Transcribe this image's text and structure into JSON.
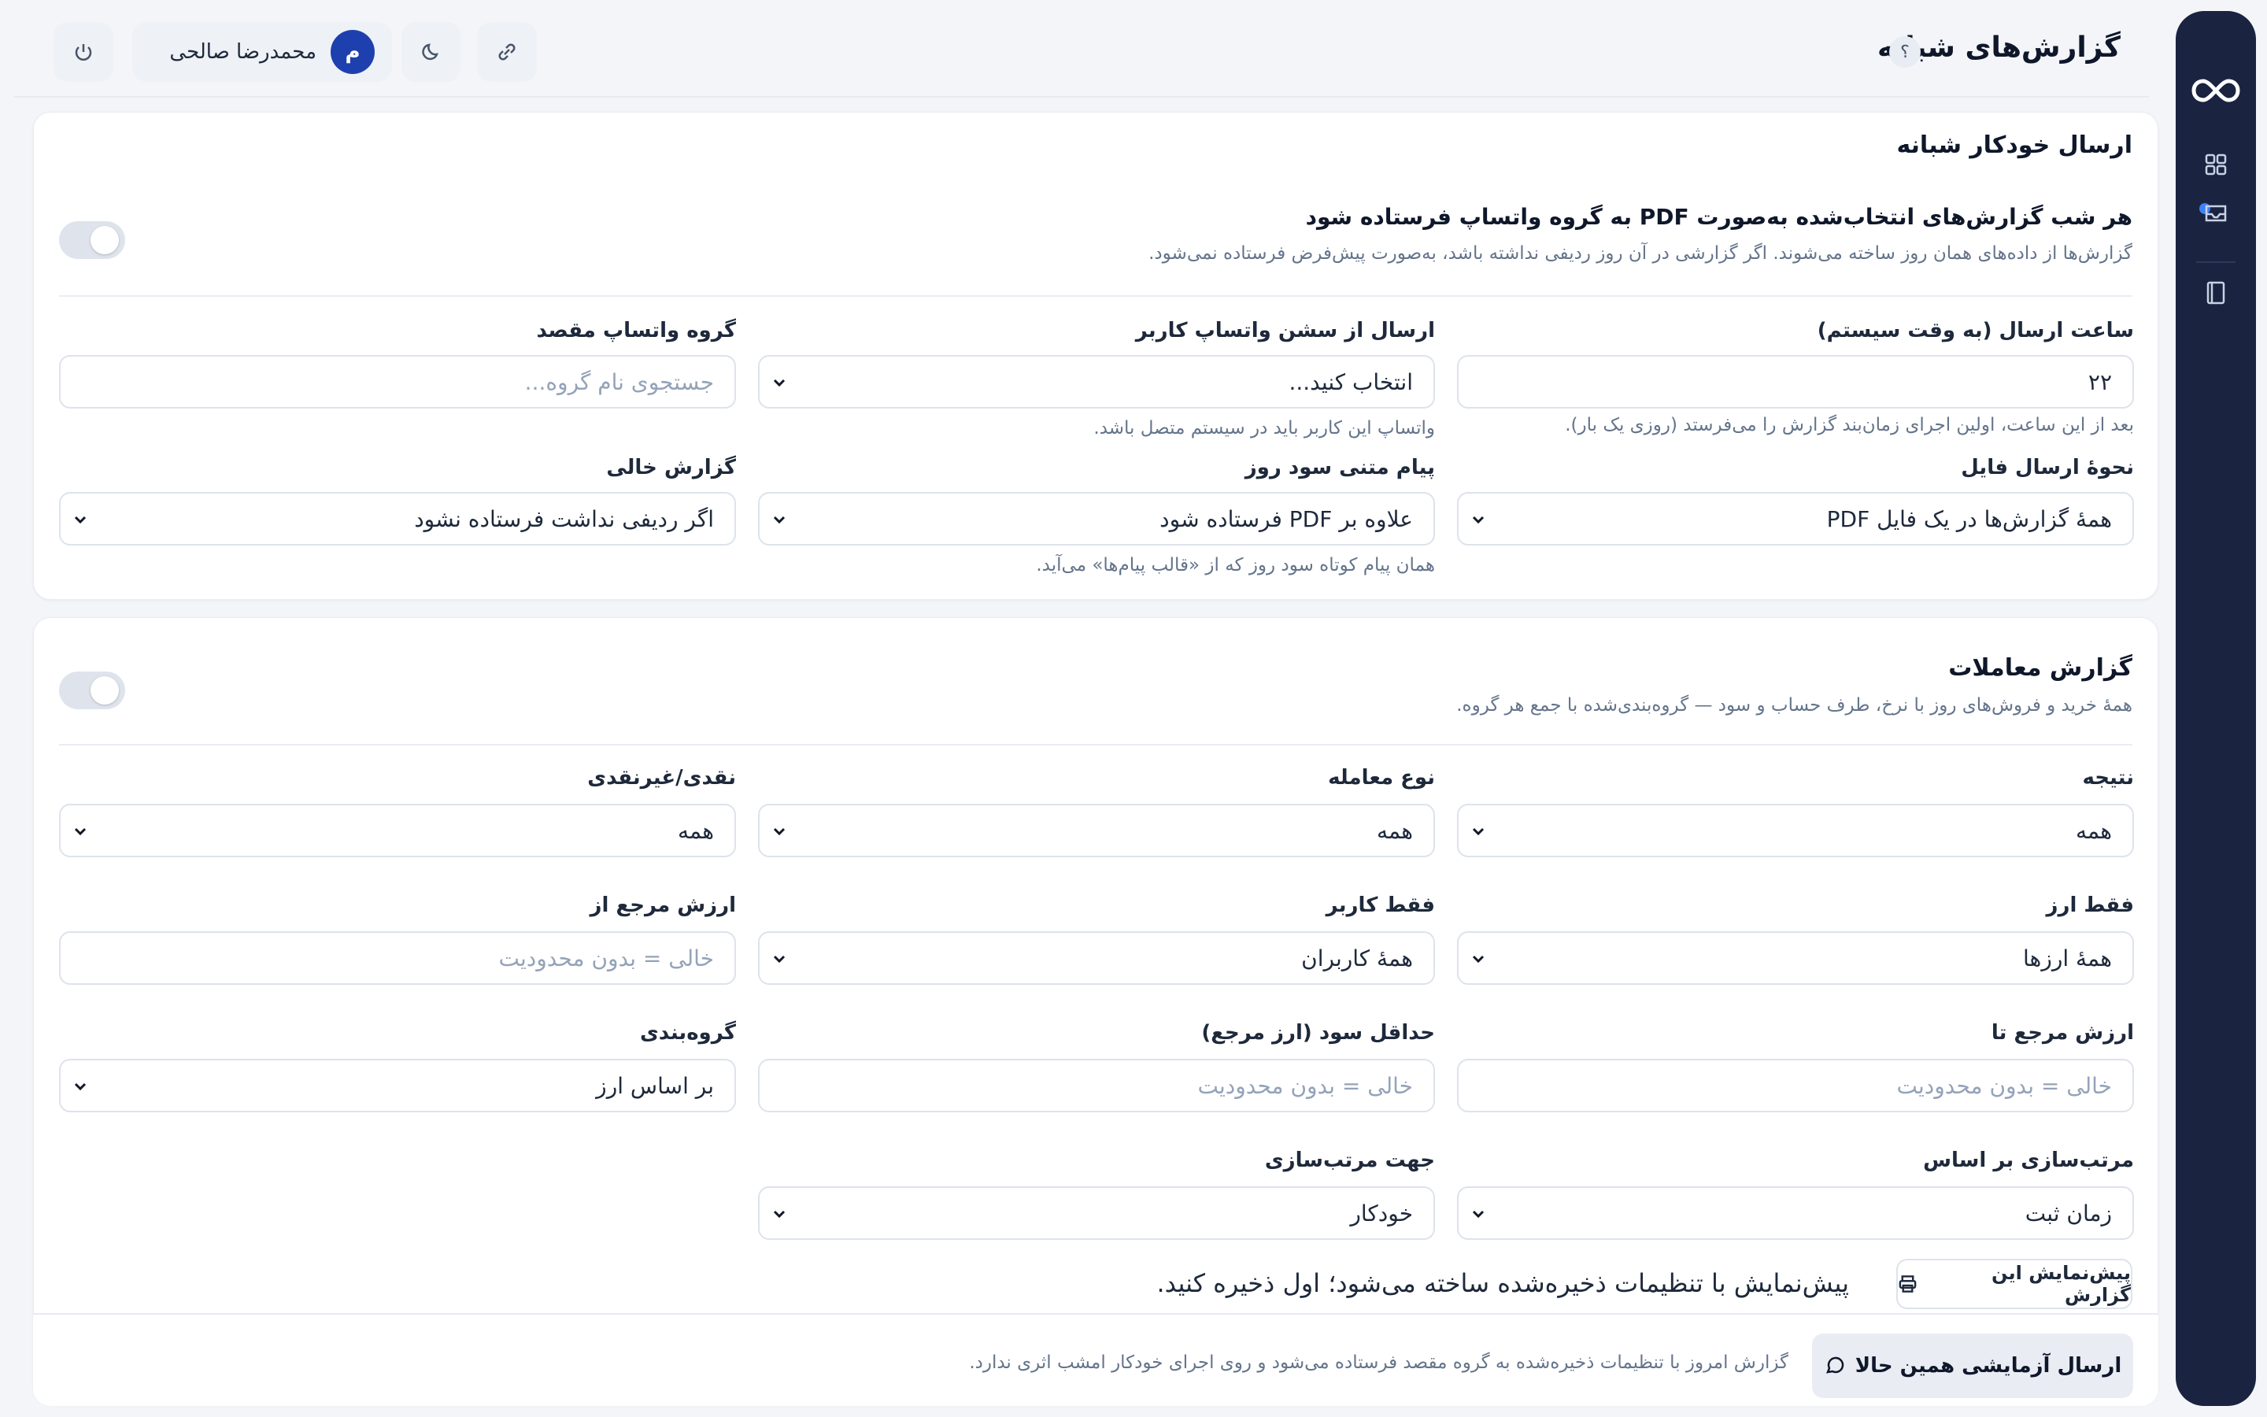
{
  "header": {
    "title": "گزارش‌های شبانه",
    "help": "؟",
    "user": {
      "initial": "م",
      "name": "محمدرضا صالحی"
    }
  },
  "auto_send": {
    "title": "ارسال خودکار شبانه",
    "toggle_title": "هر شب گزارش‌های انتخاب‌شده به‌صورت PDF به گروه واتساپ فرستاده شود",
    "toggle_sub": "گزارش‌ها از داده‌های همان روز ساخته می‌شوند. اگر گزارشی در آن روز ردیفی نداشته باشد، به‌صورت پیش‌فرض فرستاده نمی‌شود.",
    "send_time": {
      "label": "ساعت ارسال (به وقت سیستم)",
      "value": "۲۲",
      "hint": "بعد از این ساعت، اولین اجرای زمان‌بند گزارش را می‌فرستد (روزی یک بار)."
    },
    "session": {
      "label": "ارسال از سشن واتساپ کاربر",
      "value": "انتخاب کنید...",
      "hint": "واتساپ این کاربر باید در سیستم متصل باشد."
    },
    "group": {
      "label": "گروه واتساپ مقصد",
      "placeholder": "جستجوی نام گروه..."
    },
    "file_mode": {
      "label": "نحوهٔ ارسال فایل",
      "value": "همهٔ گزارش‌ها در یک فایل PDF"
    },
    "text_msg": {
      "label": "پیام متنی سود روز",
      "value": "علاوه بر PDF فرستاده شود",
      "hint": "همان پیام کوتاه سود روز که از «قالب پیام‌ها» می‌آید."
    },
    "empty_report": {
      "label": "گزارش خالی",
      "value": "اگر ردیفی نداشت فرستاده نشود"
    }
  },
  "trades": {
    "title": "گزارش معاملات",
    "sub": "همهٔ خرید و فروش‌های روز با نرخ، طرف حساب و سود — گروه‌بندی‌شده با جمع هر گروه.",
    "result": {
      "label": "نتیجه",
      "value": "همه"
    },
    "trade_type": {
      "label": "نوع معامله",
      "value": "همه"
    },
    "cash": {
      "label": "نقدی/غیرنقدی",
      "value": "همه"
    },
    "currency": {
      "label": "فقط ارز",
      "value": "همهٔ ارزها"
    },
    "user": {
      "label": "فقط کاربر",
      "value": "همهٔ کاربران"
    },
    "ref_from": {
      "label": "ارزش مرجع از",
      "placeholder": "خالی = بدون محدودیت"
    },
    "ref_to": {
      "label": "ارزش مرجع تا",
      "placeholder": "خالی = بدون محدودیت"
    },
    "min_profit": {
      "label": "حداقل سود (ارز مرجع)",
      "placeholder": "خالی = بدون محدودیت"
    },
    "grouping": {
      "label": "گروه‌بندی",
      "value": "بر اساس ارز"
    },
    "sort_by": {
      "label": "مرتب‌سازی بر اساس",
      "value": "زمان ثبت"
    },
    "sort_dir": {
      "label": "جهت مرتب‌سازی",
      "value": "خودکار"
    },
    "preview_label": "پیش‌نمایش این گزارش",
    "preview_note": "پیش‌نمایش با تنظیمات ذخیره‌شده ساخته می‌شود؛ اول ذخیره کنید."
  },
  "footer": {
    "send_label": "ارسال آزمایشی همین حالا",
    "note": "گزارش امروز با تنظیمات ذخیره‌شده به گروه مقصد فرستاده می‌شود و روی اجرای خودکار امشب اثری ندارد."
  },
  "colors": {
    "rail": "#1a2340",
    "accent": "#1e40af",
    "dot": "#3b82f6"
  }
}
